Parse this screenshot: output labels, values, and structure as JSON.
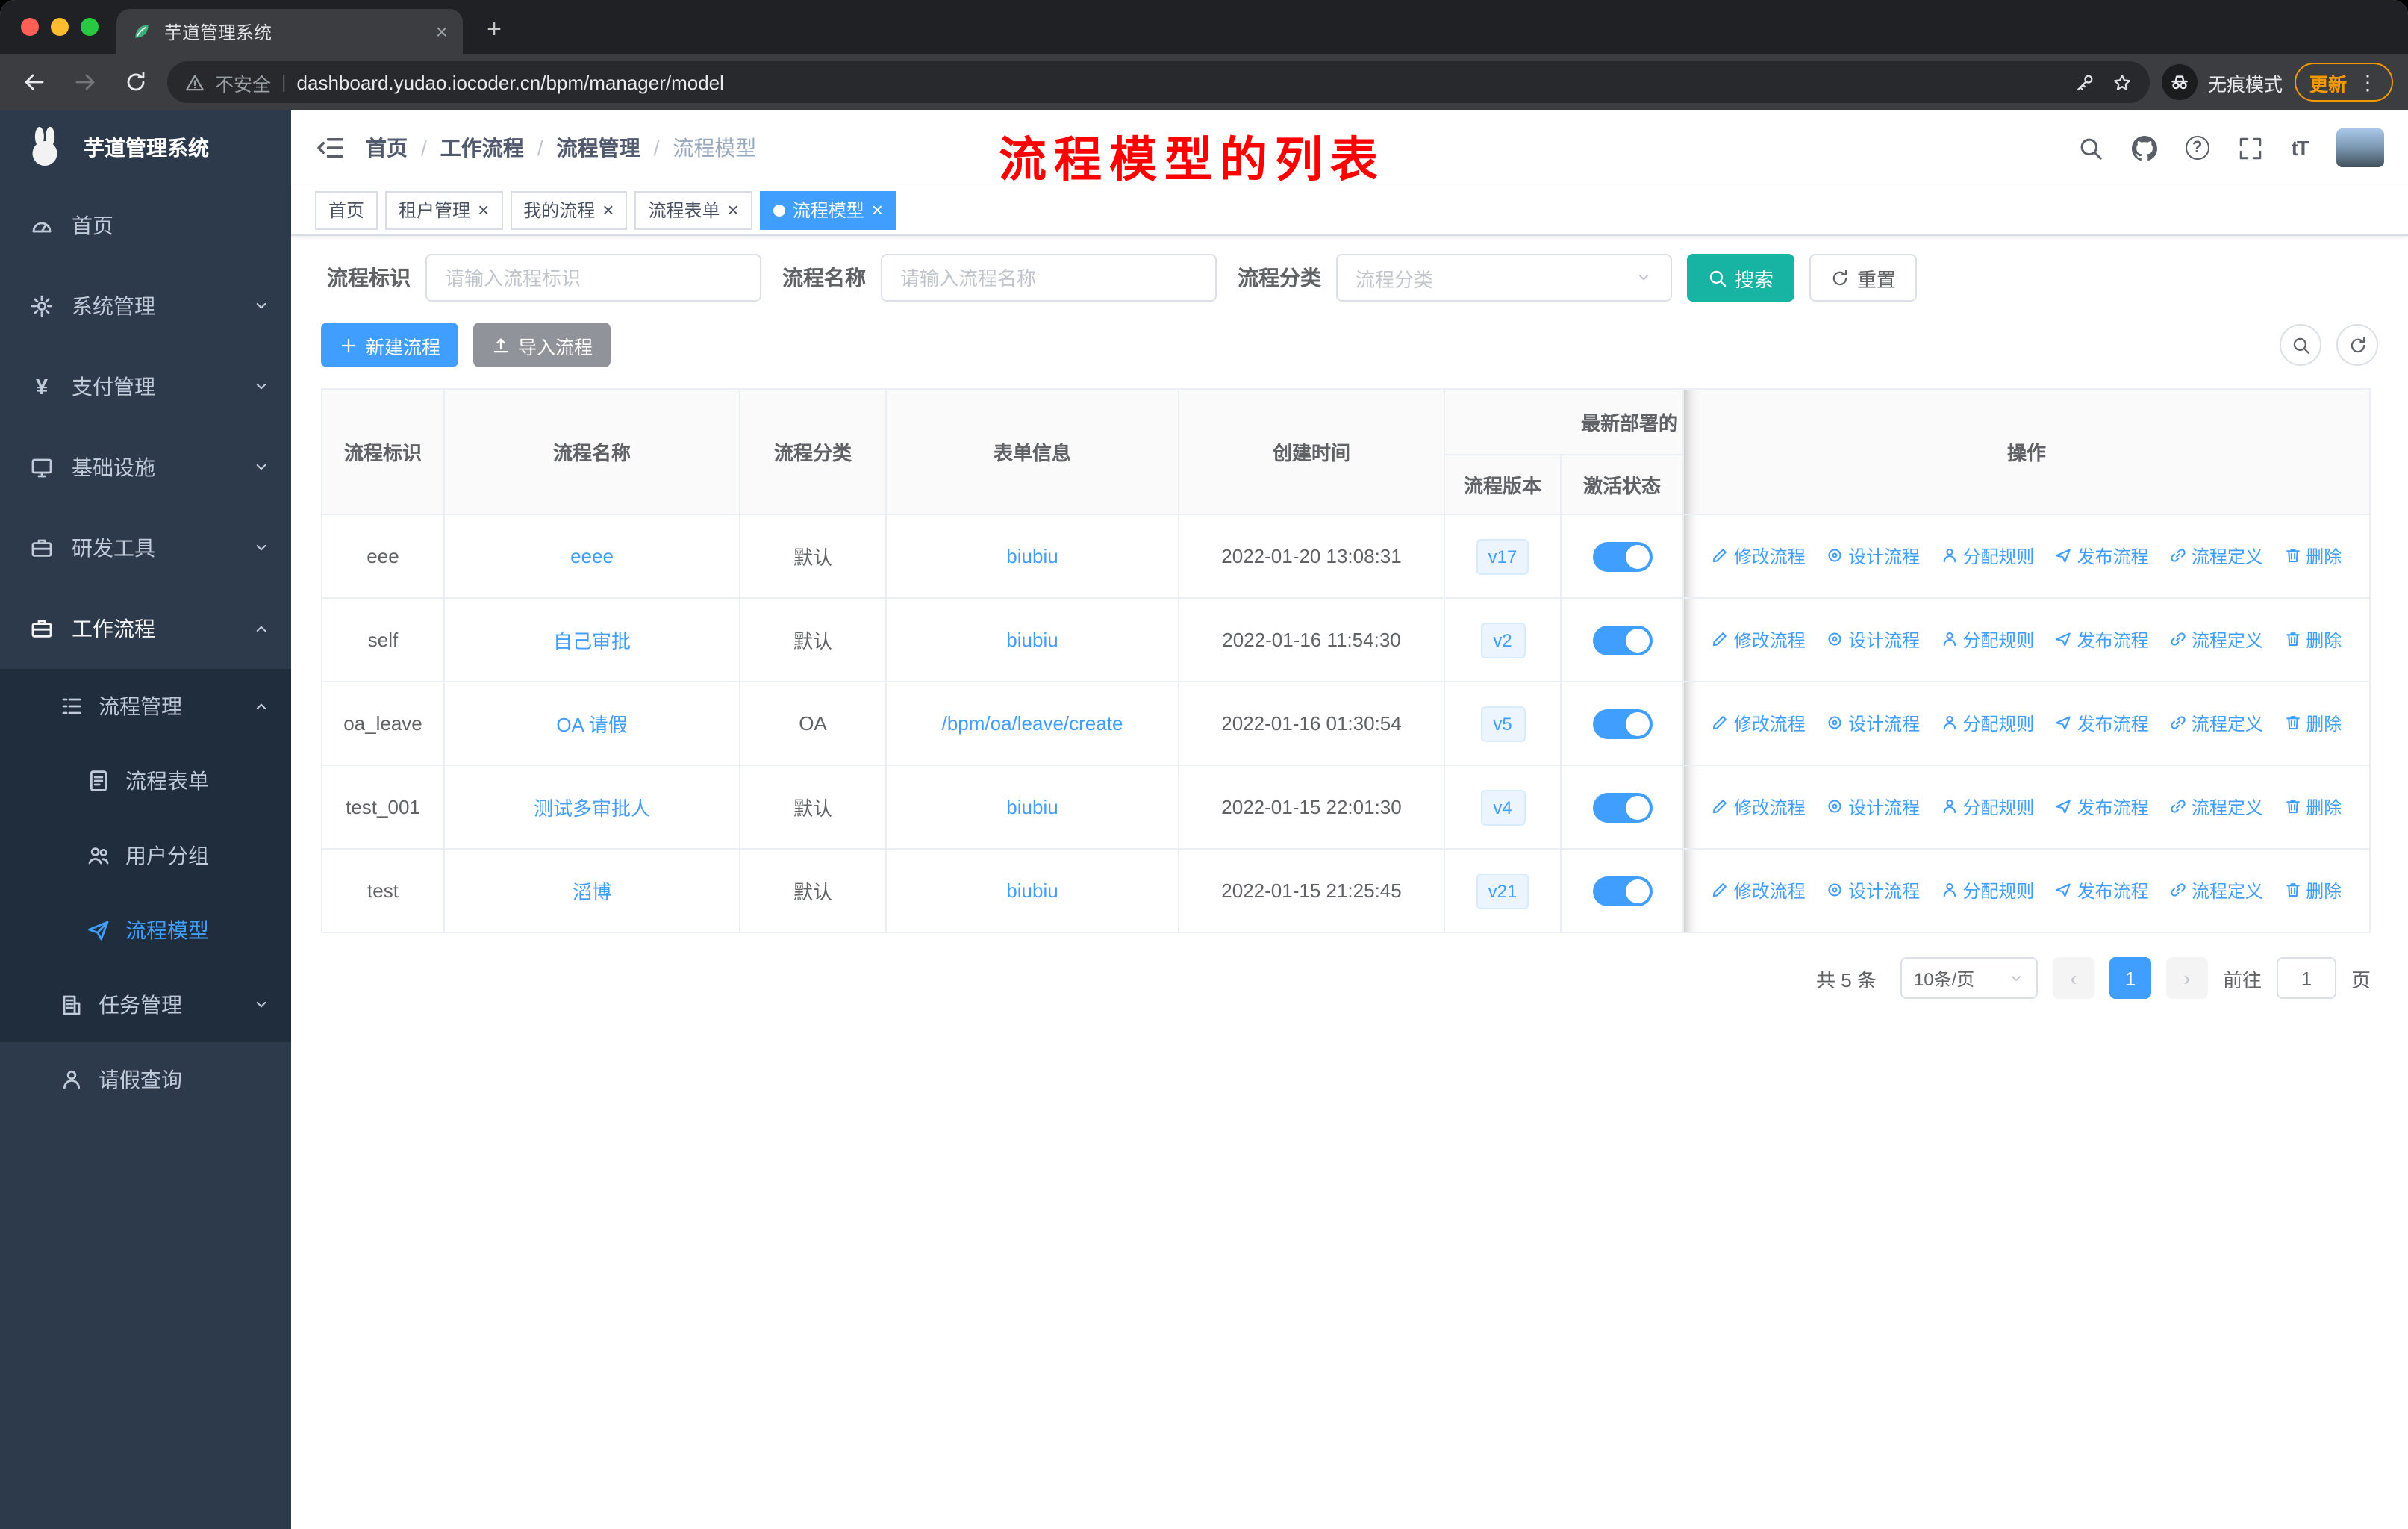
{
  "colors": {
    "primary": "#409eff",
    "search_button": "#17b3a3",
    "annotation_red": "#fe0000",
    "sidebar_bg": "#2d3a4b",
    "submenu_bg": "#1f2d3d"
  },
  "browser": {
    "tab": {
      "title": "芋道管理系统"
    },
    "address": {
      "security_label": "不安全",
      "url": "dashboard.yudao.iocoder.cn/bpm/manager/model"
    },
    "incognito_label": "无痕模式",
    "update_label": "更新"
  },
  "sidebar": {
    "logo_title": "芋道管理系统",
    "items": [
      {
        "label": "首页",
        "icon": "dashboard-gauge-icon"
      },
      {
        "label": "系统管理",
        "icon": "gear-icon"
      },
      {
        "label": "支付管理",
        "icon": "yen-icon"
      },
      {
        "label": "基础设施",
        "icon": "monitor-icon"
      },
      {
        "label": "研发工具",
        "icon": "briefcase-icon"
      },
      {
        "label": "工作流程",
        "icon": "suitcase-icon"
      }
    ],
    "process_mgmt": {
      "label": "流程管理",
      "children": [
        {
          "label": "流程表单",
          "icon": "document-icon"
        },
        {
          "label": "用户分组",
          "icon": "user-group-icon"
        },
        {
          "label": "流程模型",
          "icon": "paper-plane-icon",
          "active": true
        }
      ]
    },
    "task_mgmt": {
      "label": "任务管理",
      "icon": "building-icon"
    },
    "leave_query": {
      "label": "请假查询",
      "icon": "person-icon"
    }
  },
  "header": {
    "breadcrumbs": [
      "首页",
      "工作流程",
      "流程管理",
      "流程模型"
    ],
    "annotation": "流程模型的列表"
  },
  "tags": [
    {
      "label": "首页",
      "closable": false,
      "active": false
    },
    {
      "label": "租户管理",
      "closable": true,
      "active": false
    },
    {
      "label": "我的流程",
      "closable": true,
      "active": false
    },
    {
      "label": "流程表单",
      "closable": true,
      "active": false
    },
    {
      "label": "流程模型",
      "closable": true,
      "active": true
    }
  ],
  "filters": {
    "process_key_label": "流程标识",
    "process_key_placeholder": "请输入流程标识",
    "process_name_label": "流程名称",
    "process_name_placeholder": "请输入流程名称",
    "category_label": "流程分类",
    "category_placeholder": "流程分类",
    "search_label": "搜索",
    "reset_label": "重置"
  },
  "toolbar": {
    "create_label": "新建流程",
    "import_label": "导入流程"
  },
  "table": {
    "headers": {
      "key": "流程标识",
      "name": "流程名称",
      "category": "流程分类",
      "form": "表单信息",
      "created": "创建时间",
      "deploy_group": "最新部署的",
      "version": "流程版本",
      "status": "激活状态",
      "actions": "操作"
    },
    "action_labels": [
      "修改流程",
      "设计流程",
      "分配规则",
      "发布流程",
      "流程定义",
      "删除"
    ],
    "rows": [
      {
        "key": "eee",
        "name": "eeee",
        "category": "默认",
        "form": "biubiu",
        "created": "2022-01-20 13:08:31",
        "version": "v17",
        "active": true
      },
      {
        "key": "self",
        "name": "自己审批",
        "category": "默认",
        "form": "biubiu",
        "created": "2022-01-16 11:54:30",
        "version": "v2",
        "active": true
      },
      {
        "key": "oa_leave",
        "name": "OA 请假",
        "category": "OA",
        "form": "/bpm/oa/leave/create",
        "created": "2022-01-16 01:30:54",
        "version": "v5",
        "active": true
      },
      {
        "key": "test_001",
        "name": "测试多审批人",
        "category": "默认",
        "form": "biubiu",
        "created": "2022-01-15 22:01:30",
        "version": "v4",
        "active": true
      },
      {
        "key": "test",
        "name": "滔博",
        "category": "默认",
        "form": "biubiu",
        "created": "2022-01-15 21:25:45",
        "version": "v21",
        "active": true
      }
    ]
  },
  "pagination": {
    "total_text": "共 5 条",
    "page_size_text": "10条/页",
    "page": "1",
    "goto_label": "前往",
    "goto_value": "1",
    "unit_label": "页"
  }
}
